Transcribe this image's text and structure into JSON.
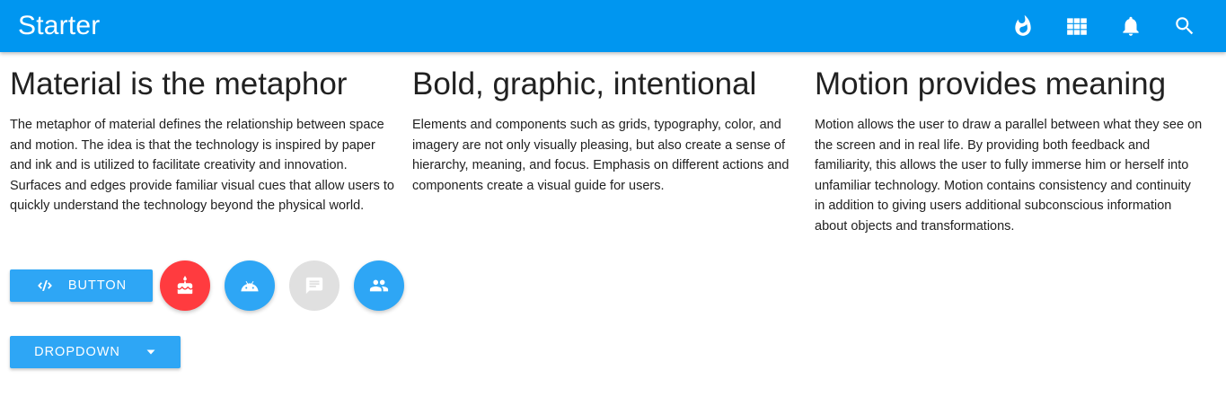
{
  "appbar": {
    "title": "Starter",
    "color": "#0096f0",
    "actions": [
      {
        "icon": "fire-icon"
      },
      {
        "icon": "apps-grid-icon"
      },
      {
        "icon": "bell-icon"
      },
      {
        "icon": "search-icon"
      }
    ]
  },
  "columns": [
    {
      "heading": "Material is the metaphor",
      "body": "The metaphor of material defines the relationship between space and motion. The idea is that the technology is inspired by paper and ink and is utilized to facilitate creativity and innovation. Surfaces and edges provide familiar visual cues that allow users to quickly understand the technology beyond the physical world."
    },
    {
      "heading": "Bold, graphic, intentional",
      "body": "Elements and components such as grids, typography, color, and imagery are not only visually pleasing, but also create a sense of hierarchy, meaning, and focus. Emphasis on different actions and components create a visual guide for users."
    },
    {
      "heading": "Motion provides meaning",
      "body": "Motion allows the user to draw a parallel between what they see on the screen and in real life. By providing both feedback and familiarity, this allows the user to fully immerse him or herself into unfamiliar technology. Motion contains consistency and continuity in addition to giving users additional subconscious information about objects and transformations."
    }
  ],
  "buttons": {
    "main_label": "BUTTON",
    "main_icon": "code-icon",
    "fabs": [
      {
        "icon": "cake-icon",
        "color": "#ff3b3f"
      },
      {
        "icon": "android-icon",
        "color": "#2ea6f5"
      },
      {
        "icon": "chat-icon",
        "color": "#e0e0e0",
        "disabled": true
      },
      {
        "icon": "group-icon",
        "color": "#2ea6f5"
      }
    ],
    "dropdown_label": "DROPDOWN",
    "dropdown_icon": "caret-down-icon"
  }
}
